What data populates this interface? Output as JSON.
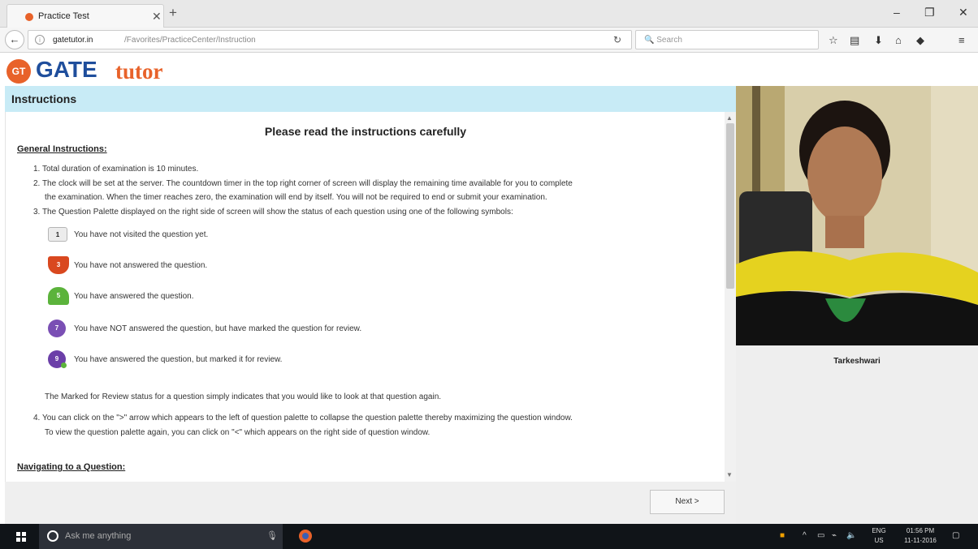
{
  "browser": {
    "tab_title": "Practice Test",
    "url_domain": "gatetutor.in",
    "url_path": "/Favorites/PracticeCenter/Instruction",
    "search_placeholder": "Search"
  },
  "logo": {
    "badge": "GT",
    "part1": "GATE",
    "part2": "tutor"
  },
  "page": {
    "section_header": "Instructions",
    "heading": "Please read the instructions carefully",
    "general_title": "General Instructions:",
    "items": [
      "1. Total duration of examination is 10 minutes.",
      "2. The clock will be set at the server. The countdown timer in the top right corner of screen will display the remaining time available for you to complete",
      "the examination. When the timer reaches zero, the examination will end by itself. You will not be required to end or submit your examination.",
      "3. The Question Palette displayed on the right side of screen will show the status of each question using one of the following symbols:"
    ],
    "legend": [
      {
        "num": "1",
        "text": "You have not visited the question yet."
      },
      {
        "num": "3",
        "text": "You have not answered the question."
      },
      {
        "num": "5",
        "text": "You have answered the question."
      },
      {
        "num": "7",
        "text": "You have NOT answered the question, but have marked the question for review."
      },
      {
        "num": "9",
        "text": "You have answered the question, but marked it for review."
      }
    ],
    "marked_note": "The Marked for Review status for a question simply indicates that you would like to look at that question again.",
    "item4_line1": "4. You can click on the \">\" arrow which appears to the left of question palette to collapse the question palette thereby maximizing the question window.",
    "item4_line2": "To view the question palette again, you can click on \"<\" which appears on the right side of question window.",
    "nav_title": "Navigating to a Question:",
    "next_label": "Next >"
  },
  "candidate": {
    "name": "Tarkeshwari"
  },
  "taskbar": {
    "search_text": "Ask me anything",
    "lang_top": "ENG",
    "lang_bottom": "US",
    "time": "01:56 PM",
    "date": "11-11-2016"
  }
}
